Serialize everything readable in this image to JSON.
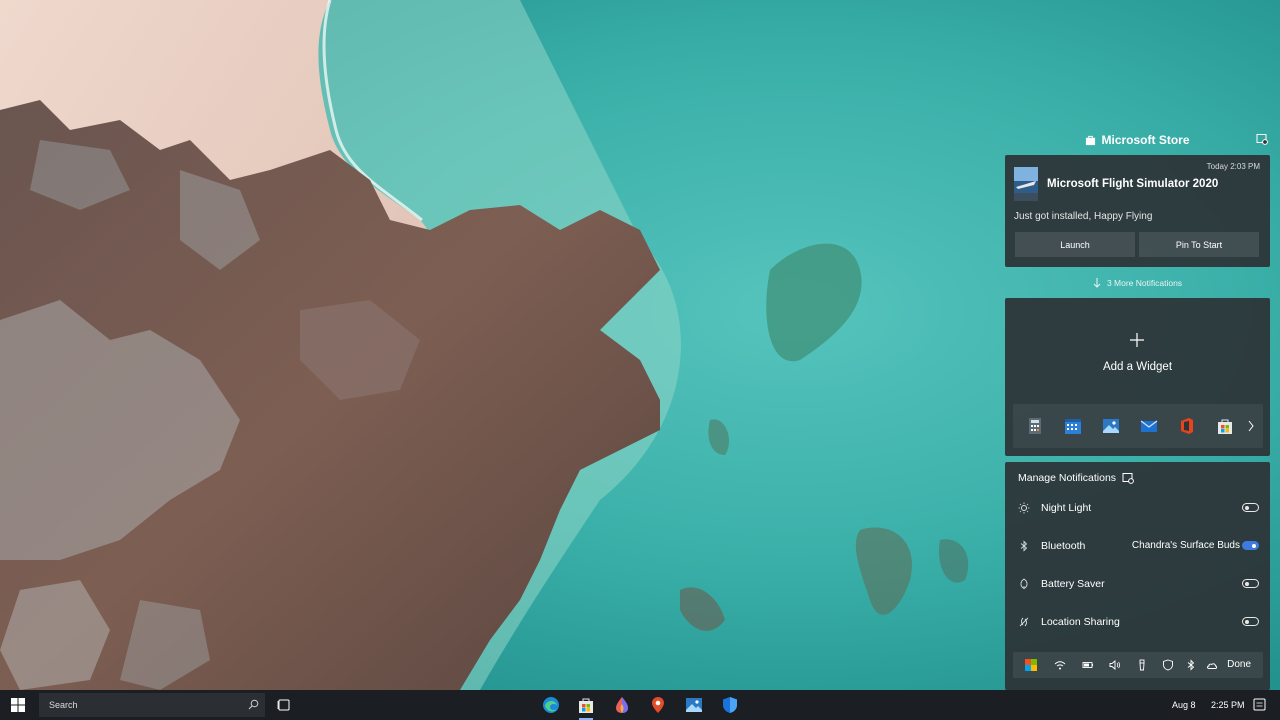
{
  "action_center": {
    "app_header": "Microsoft Store",
    "notification": {
      "time": "Today 2:03 PM",
      "title": "Microsoft Flight Simulator 2020",
      "body": "Just got installed, Happy Flying",
      "actions": {
        "launch": "Launch",
        "pin": "Pin To Start"
      }
    },
    "more_notifications": "3 More Notifications",
    "widget": {
      "add_label": "Add a Widget",
      "apps": [
        "calculator-icon",
        "calendar-icon",
        "photos-icon",
        "mail-icon",
        "office-icon",
        "store-icon"
      ]
    },
    "manage": {
      "title": "Manage Notifications",
      "toggles": [
        {
          "label": "Night Light",
          "value": "",
          "state": "off",
          "icon": "sun-icon"
        },
        {
          "label": "Bluetooth",
          "value": "Chandra's Surface Buds",
          "state": "on",
          "icon": "bluetooth-icon"
        },
        {
          "label": "Battery Saver",
          "value": "",
          "state": "off",
          "icon": "battery-saver-icon"
        },
        {
          "label": "Location Sharing",
          "value": "",
          "state": "off",
          "icon": "location-icon"
        }
      ],
      "quick_icons": [
        "color-icon",
        "wifi-icon",
        "battery-icon",
        "volume-icon",
        "flashlight-icon",
        "shield-icon",
        "bluetooth-icon",
        "cloud-icon"
      ],
      "done": "Done"
    }
  },
  "taskbar": {
    "search_placeholder": "Search",
    "pinned_apps": [
      "edge-icon",
      "store-icon",
      "paint-icon",
      "maps-icon",
      "photos-icon",
      "defender-icon"
    ],
    "date": "Aug 8",
    "time": "2:25 PM"
  },
  "colors": {
    "panel": "#2d3438",
    "toggle_on": "#3e7be0",
    "taskbar": "#1b1e22",
    "sea": "#3aa9a4",
    "sand": "#e4c9be"
  }
}
